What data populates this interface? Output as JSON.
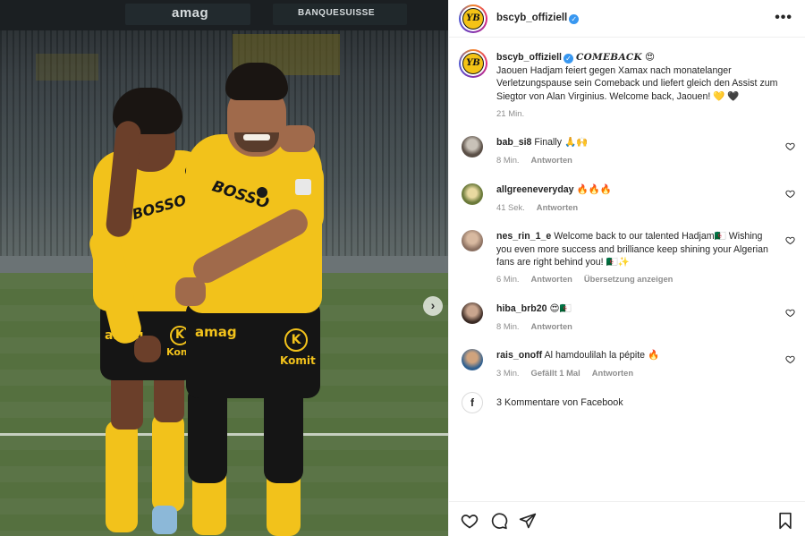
{
  "photo": {
    "banner_left": "amag",
    "banner_right": "BANQUESUISSE",
    "shirt_sponsor": "BOSSO",
    "shirt_sponsor_2": "BOSSO",
    "shorts_sponsor": "amag",
    "shorts_sponsor_2": "amag",
    "shorts_k": "K",
    "shorts_k_2": "K",
    "shorts_brand": "Komit",
    "shorts_brand_2": "Komit",
    "next_glyph": "›"
  },
  "header": {
    "username": "bscyb_offiziell",
    "verified_glyph": "✓",
    "logo_text": "YB",
    "more_glyph": "•••"
  },
  "caption": {
    "username": "bscyb_offiziell",
    "headline": "COMEBACK",
    "headline_emoji": "😍",
    "text": "Jaouen Hadjam feiert gegen Xamax nach monatelanger Verletzungspause sein Comeback und liefert gleich den Assist zum Siegtor von Alan Virginius. Welcome back, Jaouen!",
    "trailing_emojis": "💛 🖤",
    "time": "21 Min."
  },
  "comments": [
    {
      "username": "bab_si8",
      "text": "Finally 🙏🙌",
      "time": "8 Min.",
      "reply": "Antworten",
      "likes": "",
      "translate": ""
    },
    {
      "username": "allgreeneveryday",
      "text": "🔥🔥🔥",
      "time": "41 Sek.",
      "reply": "Antworten",
      "likes": "",
      "translate": ""
    },
    {
      "username": "nes_rin_1_e",
      "text": "Welcome back to our talented Hadjam🇩🇿 Wishing you even more success and brilliance keep shining your Algerian fans are right behind you! 🇩🇿✨",
      "time": "6 Min.",
      "reply": "Antworten",
      "likes": "",
      "translate": "Übersetzung anzeigen"
    },
    {
      "username": "hiba_brb20",
      "text": "😍🇩🇿",
      "time": "8 Min.",
      "reply": "Antworten",
      "likes": "",
      "translate": ""
    },
    {
      "username": "rais_onoff",
      "text": "Al hamdoulilah la pépite 🔥",
      "time": "3 Min.",
      "reply": "Antworten",
      "likes": "Gefällt 1 Mal",
      "translate": ""
    }
  ],
  "facebook": {
    "icon": "f",
    "text": "3 Kommentare von Facebook"
  },
  "colors": {
    "yb_yellow": "#f4c316",
    "verified": "#3897f0",
    "meta_gray": "#8e8e8e"
  },
  "icons": [
    "heart-icon",
    "comment-icon",
    "share-icon",
    "bookmark-icon",
    "verified-icon",
    "more-icon",
    "facebook-icon",
    "chevron-right-icon"
  ]
}
